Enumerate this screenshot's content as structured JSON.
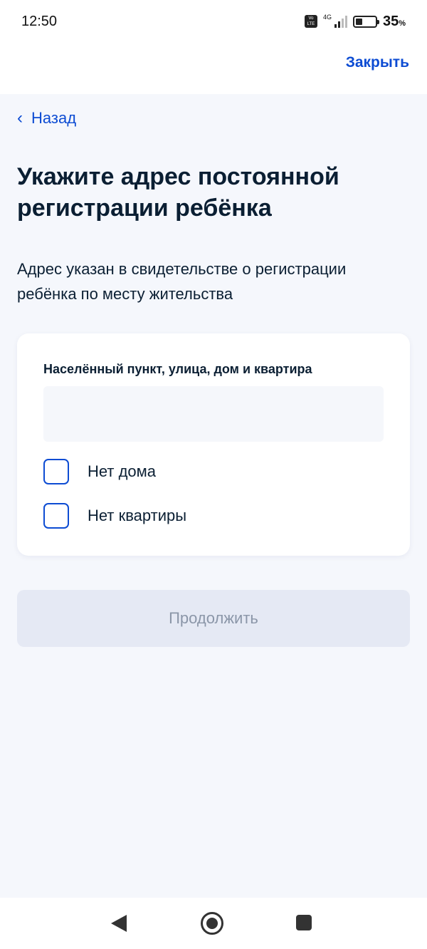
{
  "status_bar": {
    "time": "12:50",
    "network": "4G",
    "volte": "Vo LTE",
    "battery_percent": "35",
    "battery_unit": "%",
    "battery_level": 0.35
  },
  "header": {
    "close_label": "Закрыть"
  },
  "nav": {
    "back_label": "Назад",
    "back_icon": "chevron-left-icon"
  },
  "page": {
    "title": "Укажите адрес постоянной регистрации ребёнка",
    "description": "Адрес указан в свидетельстве о регистрации ребёнка по месту жительства"
  },
  "form": {
    "address_label": "Населённый пункт, улица, дом и квартира",
    "address_value": "",
    "address_placeholder": "",
    "checkboxes": [
      {
        "label": "Нет дома",
        "checked": false
      },
      {
        "label": "Нет квартиры",
        "checked": false
      }
    ]
  },
  "actions": {
    "continue_label": "Продолжить",
    "continue_disabled": true
  },
  "colors": {
    "accent": "#0d4cd3",
    "background": "#f5f7fc",
    "text": "#0b1f33",
    "disabled_button_bg": "#e5e9f4",
    "disabled_button_text": "#8b96a8"
  }
}
